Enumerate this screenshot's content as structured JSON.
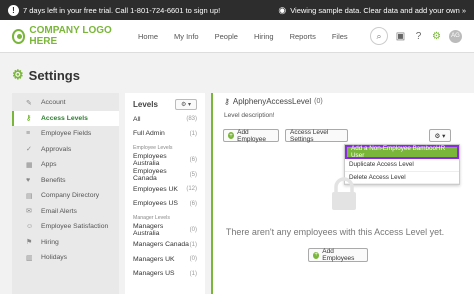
{
  "topbar": {
    "trial_text": "7 days left in your free trial. Call 1-801-724-6601 to sign up!",
    "sample_text": "Viewing sample data. Clear data and add your own »"
  },
  "nav": {
    "logo_text": "COMPANY LOGO HERE",
    "items": [
      "Home",
      "My Info",
      "People",
      "Hiring",
      "Reports",
      "Files"
    ],
    "avatar_initials": "AG"
  },
  "page": {
    "title": "Settings"
  },
  "sidebar": {
    "items": [
      {
        "label": "Account",
        "icon": "wrench-icon"
      },
      {
        "label": "Access Levels",
        "icon": "key-icon"
      },
      {
        "label": "Employee Fields",
        "icon": "list-icon"
      },
      {
        "label": "Approvals",
        "icon": "check-icon"
      },
      {
        "label": "Apps",
        "icon": "apps-icon"
      },
      {
        "label": "Benefits",
        "icon": "heart-icon"
      },
      {
        "label": "Company Directory",
        "icon": "directory-icon"
      },
      {
        "label": "Email Alerts",
        "icon": "mail-icon"
      },
      {
        "label": "Employee Satisfaction",
        "icon": "smile-icon"
      },
      {
        "label": "Hiring",
        "icon": "hiring-icon"
      },
      {
        "label": "Holidays",
        "icon": "calendar-icon"
      }
    ]
  },
  "levels": {
    "title": "Levels",
    "rows": [
      {
        "label": "All",
        "count": "(83)"
      },
      {
        "label": "Full Admin",
        "count": "(1)"
      }
    ],
    "employee_group": "Employee Levels",
    "employee_rows": [
      {
        "label": "Employees Australia",
        "count": "(6)"
      },
      {
        "label": "Employees Canada",
        "count": "(5)"
      },
      {
        "label": "Employees UK",
        "count": "(12)"
      },
      {
        "label": "Employees US",
        "count": "(6)"
      }
    ],
    "manager_group": "Manager Levels",
    "manager_rows": [
      {
        "label": "Managers Australia",
        "count": "(0)"
      },
      {
        "label": "Managers Canada",
        "count": "(1)"
      },
      {
        "label": "Managers UK",
        "count": "(0)"
      },
      {
        "label": "Managers US",
        "count": "(1)"
      }
    ]
  },
  "main": {
    "title": "AplphenyAccessLevel",
    "count": "(0)",
    "description": "Level description!",
    "add_employee_label": "Add Employee",
    "access_settings_label": "Access Level Settings",
    "gear_caret": "⚙ ▾",
    "dropdown": [
      "Add a Non-Employee BambooHR User",
      "Duplicate Access Level",
      "Delete Access Level"
    ],
    "empty_message": "There aren't any employees with this Access Level yet.",
    "add_employees_label": "Add Employees"
  },
  "colors": {
    "accent": "#7ab639",
    "highlight": "#8a2be2",
    "topbar": "#2d2d2d"
  }
}
